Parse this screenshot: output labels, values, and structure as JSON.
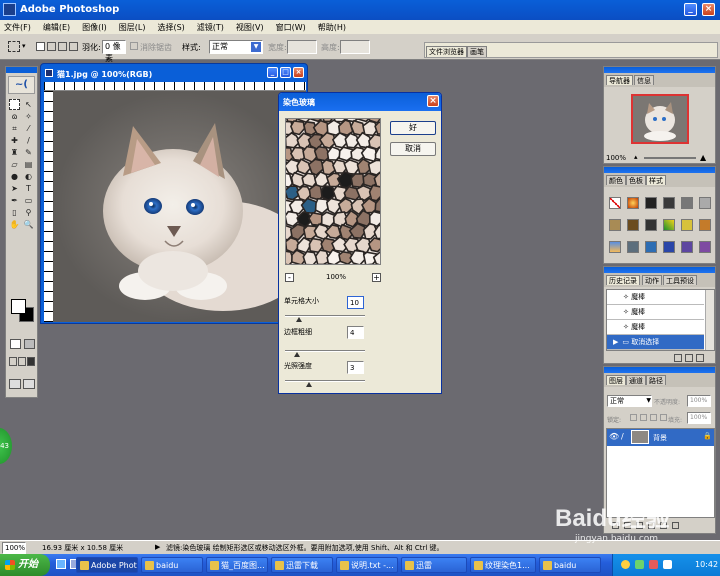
{
  "app": {
    "title": "Adobe Photoshop"
  },
  "menu": [
    "文件(F)",
    "编辑(E)",
    "图像(I)",
    "图层(L)",
    "选择(S)",
    "滤镜(T)",
    "视图(V)",
    "窗口(W)",
    "帮助(H)"
  ],
  "options": {
    "feather_label": "羽化:",
    "feather_value": "0 像素",
    "antialias_label": "消除锯齿",
    "style_label": "样式:",
    "style_value": "正常",
    "width_label": "宽度:",
    "height_label": "高度:",
    "tabs": [
      "文件浏览器",
      "画笔"
    ]
  },
  "document": {
    "title": "猫1.jpg @ 100%(RGB)"
  },
  "dialog": {
    "title": "染色玻璃",
    "ok": "好",
    "cancel": "取消",
    "zoom": "100%",
    "cell_label": "单元格大小",
    "cell_value": "10",
    "border_label": "边框粗细",
    "border_value": "4",
    "light_label": "光照强度",
    "light_value": "3"
  },
  "navigator": {
    "tabs": [
      "导航器",
      "信息"
    ],
    "zoom": "100%"
  },
  "swatches": {
    "tabs": [
      "颜色",
      "色板",
      "样式"
    ]
  },
  "history": {
    "tabs": [
      "历史记录",
      "动作",
      "工具预设"
    ],
    "items": [
      "魔棒",
      "魔棒",
      "魔棒",
      "取消选择"
    ]
  },
  "layers": {
    "tabs": [
      "图层",
      "通道",
      "路径"
    ],
    "mode": "正常",
    "opacity_label": "不透明度:",
    "opacity": "100%",
    "lock_label": "锁定:",
    "fill_label": "填充:",
    "fill": "100%",
    "layer_name": "背景"
  },
  "status": {
    "zoom": "100%",
    "size": "16.93 厘米 x 10.58 厘米",
    "message": "滤镜:染色玻璃   绘制矩形选区或移动选区外框。要用附加选项,使用 Shift、Alt 和 Ctrl 键。"
  },
  "taskbar": {
    "start": "开始",
    "items": [
      "Adobe Phot...",
      "baidu",
      "猫_百度图...",
      "迅雷下载",
      "说明.txt -...",
      "迅雷",
      "纹理染色1...",
      "baidu"
    ],
    "clock": "10:42"
  },
  "watermark": {
    "text": "Baidu经验",
    "url": "jingyan.baidu.com"
  },
  "colors": {
    "titlebar": "#0a5fd8",
    "taskbar": "#245edb",
    "start": "#3c9a3c",
    "workspace": "#6b6a70"
  }
}
